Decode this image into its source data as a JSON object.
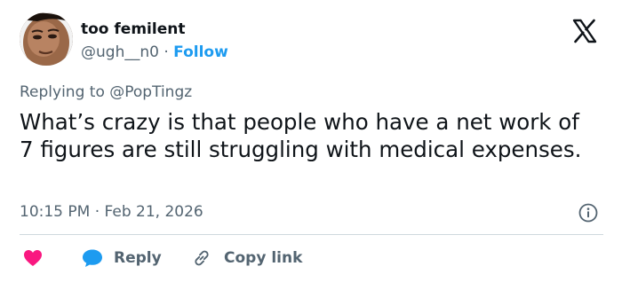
{
  "author": {
    "display_name": "too femilent",
    "handle": "@ugh__n0",
    "separator": "·",
    "follow_label": "Follow"
  },
  "reply_context": {
    "prefix": "Replying to",
    "target": "@PopTingz"
  },
  "post": {
    "text": "What’s crazy is that people who have a net work of 7 figures are still struggling with medical expenses.",
    "timestamp": "10:15 PM · Feb 21, 2026"
  },
  "actions": {
    "reply_label": "Reply",
    "copy_label": "Copy link"
  },
  "colors": {
    "accent": "#1d9bf0",
    "like": "#f91880",
    "text": "#0f1419",
    "muted": "#536471",
    "divider": "#cfd9de"
  },
  "icons": {
    "platform": "x-logo-icon",
    "info": "info-icon",
    "like": "heart-icon",
    "reply": "reply-bubble-icon",
    "copy": "link-icon"
  }
}
